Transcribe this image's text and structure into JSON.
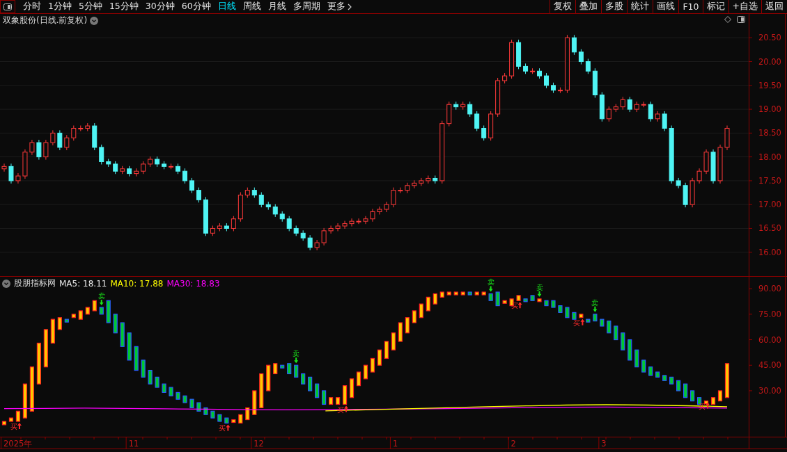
{
  "toolbar": {
    "periods": [
      {
        "label": "分时",
        "selected": false
      },
      {
        "label": "1分钟",
        "selected": false
      },
      {
        "label": "5分钟",
        "selected": false
      },
      {
        "label": "15分钟",
        "selected": false
      },
      {
        "label": "30分钟",
        "selected": false
      },
      {
        "label": "60分钟",
        "selected": false
      },
      {
        "label": "日线",
        "selected": true
      },
      {
        "label": "周线",
        "selected": false
      },
      {
        "label": "月线",
        "selected": false
      },
      {
        "label": "多周期",
        "selected": false
      },
      {
        "label": "更多",
        "selected": false
      }
    ],
    "actions": [
      "复权",
      "叠加",
      "多股",
      "统计",
      "画线",
      "F10",
      "标记",
      "+自选",
      "返回"
    ]
  },
  "price_panel": {
    "title": "双象股份(日线.前复权)",
    "price_axis": [
      "20.50",
      "20.00",
      "19.50",
      "19.00",
      "18.50",
      "18.00",
      "17.50",
      "17.00",
      "16.50",
      "16.00"
    ]
  },
  "indicator_panel": {
    "title": "股朋指标网",
    "legend": [
      {
        "text": "MA5: 18.11",
        "color": "#e8e8e8"
      },
      {
        "text": "MA10: 17.88",
        "color": "#ffff00"
      },
      {
        "text": "MA30: 18.83",
        "color": "#ff00ff"
      }
    ],
    "value_axis": [
      "90.00",
      "75.00",
      "60.00",
      "45.00",
      "30.00"
    ],
    "signals": [
      {
        "kind": "buy",
        "label": "买"
      },
      {
        "kind": "sell",
        "label": "卖"
      },
      {
        "kind": "buy",
        "label": "买"
      },
      {
        "kind": "sell",
        "label": "卖"
      },
      {
        "kind": "buy",
        "label": "买"
      },
      {
        "kind": "sell",
        "label": "卖"
      },
      {
        "kind": "buy",
        "label": "买"
      },
      {
        "kind": "sell",
        "label": "卖"
      },
      {
        "kind": "buy",
        "label": "买"
      },
      {
        "kind": "sell",
        "label": "卖"
      },
      {
        "kind": "buy",
        "label": "买"
      }
    ]
  },
  "date_axis": [
    "2025年",
    "11",
    "12",
    "1",
    "2",
    "3"
  ]
}
